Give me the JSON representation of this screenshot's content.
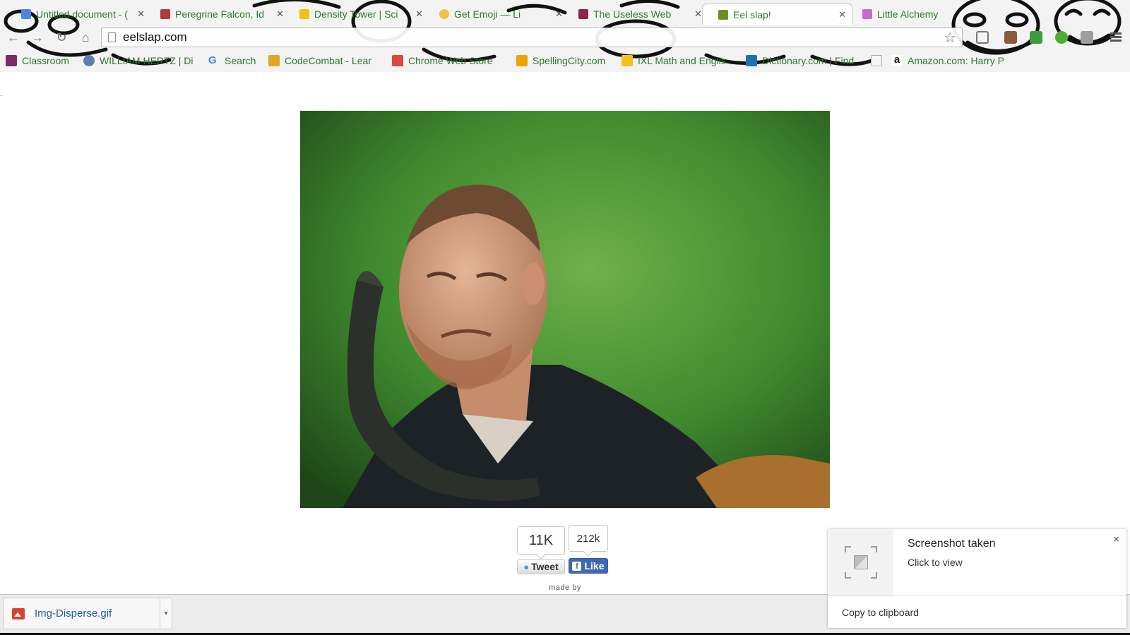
{
  "tabs": [
    {
      "label": "Untitled document - (",
      "favicon_color": "#4a86e8",
      "active": false
    },
    {
      "label": "Peregrine Falcon, Id",
      "favicon_color": "#b33a3a",
      "active": false
    },
    {
      "label": "Density Tower | Sci",
      "favicon_color": "#f4c20d",
      "active": false
    },
    {
      "label": "Get Emoji — Li",
      "favicon_color": "#f0c33c",
      "active": false
    },
    {
      "label": "The Useless Web",
      "favicon_color": "#8e244d",
      "active": false
    },
    {
      "label": "Eel slap!",
      "favicon_color": "#6b8e23",
      "active": true
    },
    {
      "label": "Little Alchemy",
      "favicon_color": "#c96ad1",
      "active": false
    }
  ],
  "toolbar": {
    "url": "eelslap.com",
    "back_icon": "arrow-left-icon",
    "forward_icon": "arrow-right-icon",
    "reload_icon": "reload-icon",
    "home_icon": "home-icon",
    "star_icon": "star-icon"
  },
  "bookmarks": [
    {
      "label": "Classroom",
      "icon_color": "#3d9a3d"
    },
    {
      "label": "WILLIAM HERTZ | Di",
      "icon_color": "#5b7fae"
    },
    {
      "label": "Search",
      "icon_color": "#4285f4"
    },
    {
      "label": "CodeCombat - Lear",
      "icon_color": "#e0a526"
    },
    {
      "label": "Chrome Web Store",
      "icon_color": "#d94a38"
    },
    {
      "label": "SpellingCity.com",
      "icon_color": "#f0a300"
    },
    {
      "label": "IXL Math and Englis",
      "icon_color": "#f2c21a"
    },
    {
      "label": "Dictionary.com | Find",
      "icon_color": "#1f6fb6"
    },
    {
      "label": "",
      "icon_color": "#dddddd"
    },
    {
      "label": "Amazon.com: Harry P",
      "icon_color": "#ffffff"
    }
  ],
  "share": {
    "tweet_count": "11K",
    "tweet_label": "Tweet",
    "like_count": "212k",
    "like_label": "Like",
    "made_by": "made by"
  },
  "download": {
    "filename": "Img-Disperse.gif",
    "caret": "▾"
  },
  "notification": {
    "title": "Screenshot taken",
    "subtitle": "Click to view",
    "action": "Copy to clipboard",
    "close": "×"
  },
  "colors": {
    "tab_text": "#2a7a2a",
    "like_blue": "#4267b2",
    "twitter_blue": "#2aa3ef",
    "photo_green": "#3f8a2e"
  }
}
